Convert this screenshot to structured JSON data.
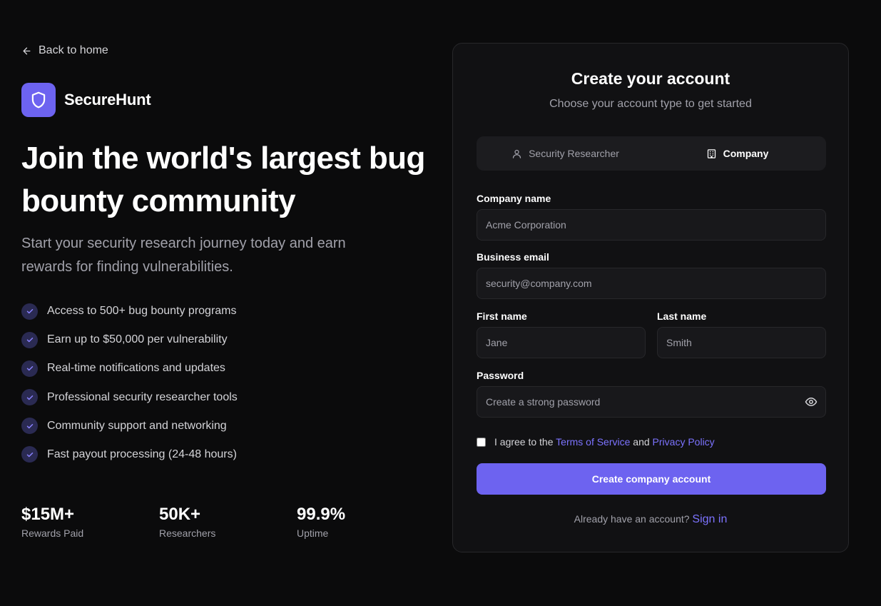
{
  "nav": {
    "back_label": "Back to home"
  },
  "brand": {
    "name": "SecureHunt",
    "color": "#6d63f0"
  },
  "hero": {
    "headline": "Join the world's largest bug bounty community",
    "subheadline": "Start your security research journey today and earn rewards for finding vulnerabilities."
  },
  "features": [
    "Access to 500+ bug bounty programs",
    "Earn up to $50,000 per vulnerability",
    "Real-time notifications and updates",
    "Professional security researcher tools",
    "Community support and networking",
    "Fast payout processing (24-48 hours)"
  ],
  "stats": [
    {
      "value": "$15M+",
      "label": "Rewards Paid"
    },
    {
      "value": "50K+",
      "label": "Researchers"
    },
    {
      "value": "99.9%",
      "label": "Uptime"
    }
  ],
  "form": {
    "title": "Create your account",
    "subtitle": "Choose your account type to get started",
    "account_types": [
      {
        "label": "Security Researcher",
        "icon": "user-icon",
        "active": false
      },
      {
        "label": "Company",
        "icon": "building-icon",
        "active": true
      }
    ],
    "company_name": {
      "label": "Company name",
      "placeholder": "Acme Corporation"
    },
    "business_email": {
      "label": "Business email",
      "placeholder": "security@company.com"
    },
    "first_name": {
      "label": "First name",
      "placeholder": "Jane"
    },
    "last_name": {
      "label": "Last name",
      "placeholder": "Smith"
    },
    "password": {
      "label": "Password",
      "placeholder": "Create a strong password"
    },
    "agree": {
      "prefix": "I agree to the",
      "terms": "Terms of Service",
      "and": "and",
      "privacy": "Privacy Policy",
      "checked": false
    },
    "submit_label": "Create company account",
    "signin_prompt": "Already have an account?",
    "signin_link": "Sign in"
  },
  "colors": {
    "accent": "#6d63f0",
    "link": "#7c73ff",
    "background": "#0b0b0c",
    "card": "#111113"
  }
}
